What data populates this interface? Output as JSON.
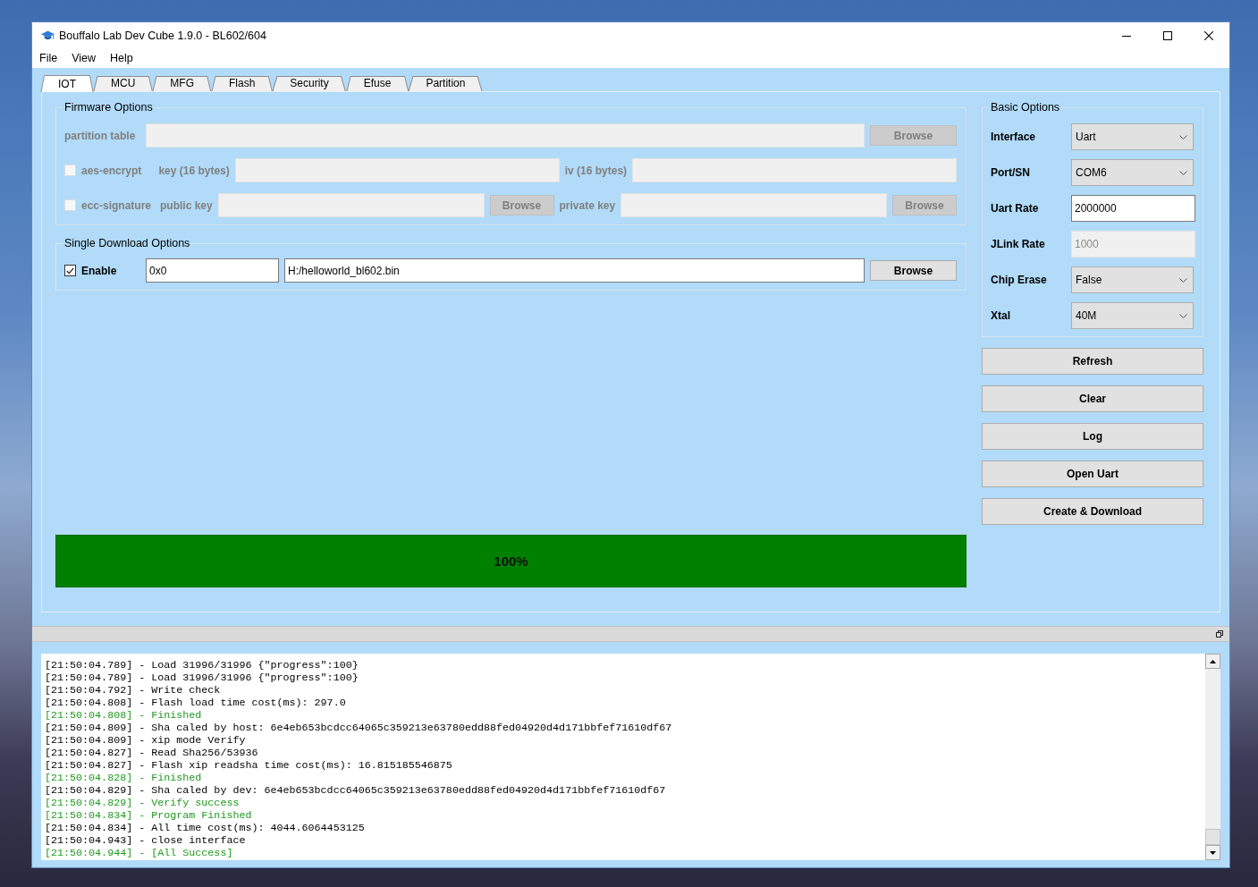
{
  "window": {
    "title": "Bouffalo Lab Dev Cube 1.9.0 - BL602/604"
  },
  "menu": [
    "File",
    "View",
    "Help"
  ],
  "tabs": [
    {
      "label": "IOT",
      "selected": true
    },
    {
      "label": "MCU",
      "selected": false
    },
    {
      "label": "MFG",
      "selected": false
    },
    {
      "label": "Flash",
      "selected": false
    },
    {
      "label": "Security",
      "selected": false
    },
    {
      "label": "Efuse",
      "selected": false
    },
    {
      "label": "Partition",
      "selected": false
    }
  ],
  "firmware_options": {
    "title": "Firmware Options",
    "disabled": true,
    "partition_table": {
      "label": "partition table",
      "button": "Browse"
    },
    "aes_encrypt": {
      "label": "aes-encrypt",
      "checked": false,
      "key_label": "key (16 bytes)",
      "iv_label": "iv (16 bytes)"
    },
    "ecc_signature": {
      "label": "ecc-signature",
      "checked": false,
      "public_key_label": "public key",
      "public_key_button": "Browse",
      "private_key_label": "private key",
      "private_key_button": "Browse"
    }
  },
  "single_download": {
    "title": "Single Download Options",
    "enable": {
      "label": "Enable",
      "checked": true
    },
    "address": "0x0",
    "file": "H:/helloworld_bl602.bin",
    "button": "Browse"
  },
  "basic_options": {
    "title": "Basic Options",
    "fields": [
      {
        "label": "Interface",
        "kind": "select",
        "value": "Uart",
        "disabled": false
      },
      {
        "label": "Port/SN",
        "kind": "select",
        "value": "COM6",
        "disabled": false
      },
      {
        "label": "Uart Rate",
        "kind": "input",
        "value": "2000000",
        "disabled": false
      },
      {
        "label": "JLink Rate",
        "kind": "input",
        "value": "1000",
        "disabled": true
      },
      {
        "label": "Chip Erase",
        "kind": "select",
        "value": "False",
        "disabled": false
      },
      {
        "label": "Xtal",
        "kind": "select",
        "value": "40M",
        "disabled": false
      }
    ]
  },
  "actions": [
    "Refresh",
    "Clear",
    "Log",
    "Open Uart",
    "Create & Download"
  ],
  "progress": {
    "level": 1,
    "reading": "100%"
  },
  "log": {
    "lines": [
      {
        "text": "[21:50:04.789] - Load 31996/31996 {\"progress\":100}",
        "kind": "info"
      },
      {
        "text": "[21:50:04.789] - Load 31996/31996 {\"progress\":100}",
        "kind": "info"
      },
      {
        "text": "[21:50:04.792] - Write check",
        "kind": "info"
      },
      {
        "text": "[21:50:04.808] - Flash load time cost(ms): 297.0",
        "kind": "info"
      },
      {
        "text": "[21:50:04.808] - Finished",
        "kind": "success"
      },
      {
        "text": "[21:50:04.809] - Sha caled by host: 6e4eb653bcdcc64065c359213e63780edd88fed04920d4d171bbfef71610df67",
        "kind": "info"
      },
      {
        "text": "[21:50:04.809] - xip mode Verify",
        "kind": "info"
      },
      {
        "text": "[21:50:04.827] - Read Sha256/53936",
        "kind": "info"
      },
      {
        "text": "[21:50:04.827] - Flash xip readsha time cost(ms): 16.815185546875",
        "kind": "info"
      },
      {
        "text": "[21:50:04.828] - Finished",
        "kind": "success"
      },
      {
        "text": "[21:50:04.829] - Sha caled by dev: 6e4eb653bcdcc64065c359213e63780edd88fed04920d4d171bbfef71610df67",
        "kind": "info"
      },
      {
        "text": "[21:50:04.829] - Verify success",
        "kind": "success"
      },
      {
        "text": "[21:50:04.834] - Program Finished",
        "kind": "success"
      },
      {
        "text": "[21:50:04.834] - All time cost(ms): 4044.6064453125",
        "kind": "info"
      },
      {
        "text": "[21:50:04.943] - close interface",
        "kind": "info"
      },
      {
        "text": "[21:50:04.944] - [All Success]",
        "kind": "success"
      }
    ]
  }
}
